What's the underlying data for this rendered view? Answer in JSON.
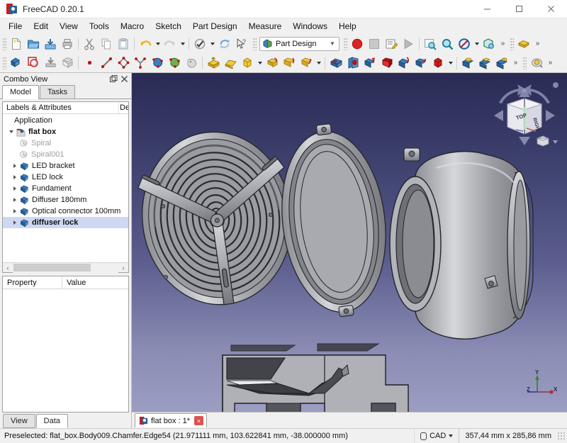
{
  "window": {
    "title": "FreeCAD 0.20.1",
    "app_icon": "freecad-logo-icon",
    "minimize": "minimize-button",
    "maximize": "maximize-button",
    "close": "close-button"
  },
  "menubar": {
    "items": [
      {
        "label": "File"
      },
      {
        "label": "Edit"
      },
      {
        "label": "View"
      },
      {
        "label": "Tools"
      },
      {
        "label": "Macro"
      },
      {
        "label": "Sketch"
      },
      {
        "label": "Part Design"
      },
      {
        "label": "Measure"
      },
      {
        "label": "Windows"
      },
      {
        "label": "Help"
      }
    ]
  },
  "toolbars": {
    "file": [
      {
        "name": "new-document-icon"
      },
      {
        "name": "open-document-icon"
      },
      {
        "name": "save-document-icon"
      },
      {
        "name": "print-document-icon"
      },
      {
        "name": "cut-icon"
      },
      {
        "name": "copy-icon"
      },
      {
        "name": "paste-icon"
      },
      {
        "name": "undo-icon"
      },
      {
        "name": "redo-icon"
      },
      {
        "name": "refresh-icon"
      },
      {
        "name": "whats-this-icon"
      }
    ],
    "workbench": {
      "selected": "Part Design",
      "icon": "part-design-workbench-icon"
    },
    "macro": [
      {
        "name": "macro-record-icon"
      },
      {
        "name": "macro-stop-icon"
      },
      {
        "name": "macro-edit-icon"
      },
      {
        "name": "macro-execute-icon"
      }
    ],
    "view": [
      {
        "name": "fit-all-icon"
      },
      {
        "name": "zoom-selection-icon"
      },
      {
        "name": "draw-style-icon"
      },
      {
        "name": "axonometric-view-icon"
      }
    ],
    "structure": [
      {
        "name": "create-part-icon"
      },
      {
        "name": "create-body-icon"
      },
      {
        "name": "create-group-icon"
      },
      {
        "name": "create-link-icon"
      }
    ],
    "sketcher": [
      {
        "name": "create-point-icon"
      },
      {
        "name": "create-line-icon"
      },
      {
        "name": "create-polyline-icon"
      },
      {
        "name": "create-arc-icon"
      },
      {
        "name": "create-sketch-icon"
      },
      {
        "name": "edit-sketch-icon"
      },
      {
        "name": "map-sketch-icon"
      }
    ],
    "additive": [
      {
        "name": "pad-icon"
      },
      {
        "name": "revolution-icon"
      },
      {
        "name": "additive-loft-icon"
      },
      {
        "name": "additive-pipe-icon"
      }
    ],
    "subtractive": [
      {
        "name": "pocket-icon"
      },
      {
        "name": "hole-icon"
      },
      {
        "name": "groove-icon"
      },
      {
        "name": "subtractive-loft-icon"
      },
      {
        "name": "subtractive-pipe-icon"
      },
      {
        "name": "subtractive-primitive-icon"
      }
    ],
    "dress_up": [
      {
        "name": "fillet-icon"
      },
      {
        "name": "chamfer-icon"
      },
      {
        "name": "draft-icon"
      },
      {
        "name": "thickness-icon"
      }
    ],
    "transform": [
      {
        "name": "mirrored-icon"
      }
    ],
    "overflow_label": "»"
  },
  "combo_view": {
    "title": "Combo View",
    "float_button": "float-panel-icon",
    "close_button": "close-panel-icon",
    "tabs": [
      {
        "label": "Model",
        "active": true
      },
      {
        "label": "Tasks",
        "active": false
      }
    ],
    "tree": {
      "columns": [
        "Labels & Attributes",
        "De"
      ],
      "root": "Application",
      "nodes": [
        {
          "label": "flat box",
          "indent": 1,
          "arrow": "down",
          "icon": "document-icon",
          "bold": true,
          "dim": false,
          "selected": false
        },
        {
          "label": "Spiral",
          "indent": 2,
          "arrow": "none",
          "icon": "spiral-icon",
          "bold": false,
          "dim": true,
          "selected": false
        },
        {
          "label": "Spiral001",
          "indent": 2,
          "arrow": "none",
          "icon": "spiral-icon",
          "bold": false,
          "dim": true,
          "selected": false
        },
        {
          "label": "LED bracket",
          "indent": 1,
          "arrow": "right",
          "icon": "body-icon",
          "bold": false,
          "dim": false,
          "selected": false
        },
        {
          "label": "LED lock",
          "indent": 1,
          "arrow": "right",
          "icon": "body-icon",
          "bold": false,
          "dim": false,
          "selected": false
        },
        {
          "label": "Fundament",
          "indent": 1,
          "arrow": "right",
          "icon": "body-icon",
          "bold": false,
          "dim": false,
          "selected": false
        },
        {
          "label": "Diffuser 180mm",
          "indent": 1,
          "arrow": "right",
          "icon": "body-icon",
          "bold": false,
          "dim": false,
          "selected": false
        },
        {
          "label": "Optical connector 100mm",
          "indent": 1,
          "arrow": "right",
          "icon": "body-icon",
          "bold": false,
          "dim": false,
          "selected": false
        },
        {
          "label": "diffuser lock",
          "indent": 1,
          "arrow": "right",
          "icon": "body-icon",
          "bold": true,
          "dim": false,
          "selected": true
        }
      ],
      "scroll_left": "‹",
      "scroll_right": "›"
    },
    "property_editor": {
      "columns": [
        "Property",
        "Value"
      ],
      "rows": []
    },
    "bottom_tabs": [
      {
        "label": "View",
        "active": false
      },
      {
        "label": "Data",
        "active": true
      }
    ]
  },
  "view3d": {
    "navigation_cube": {
      "top_face": "TOP",
      "right_face": "RIGHT",
      "corner_icon": "cube-menu-icon",
      "arrow_up": "nav-arrow-up",
      "arrow_down": "nav-arrow-down",
      "arrow_left": "nav-arrow-left",
      "arrow_right": "nav-arrow-right",
      "rotate_ccw": "nav-rotate-ccw",
      "rotate_cw": "nav-rotate-cw"
    },
    "axis_indicator": {
      "x": "X",
      "y": "Y",
      "z": "Z"
    },
    "background_top": "#292b55",
    "background_bottom": "#9b9dc2",
    "model_color": "#aaabb0"
  },
  "document_tabs": [
    {
      "label": "flat box : 1*",
      "icon": "freecad-doc-icon",
      "close": "×",
      "active": true
    }
  ],
  "status_bar": {
    "message": "Preselected: flat_box.Body009.Chamfer.Edge54 (21.971111 mm, 103.622841 mm, -38.000000 mm)",
    "unit_system": "CAD",
    "unit_icon": "unit-system-icon",
    "dimensions": "357,44 mm x 285,86 mm"
  }
}
